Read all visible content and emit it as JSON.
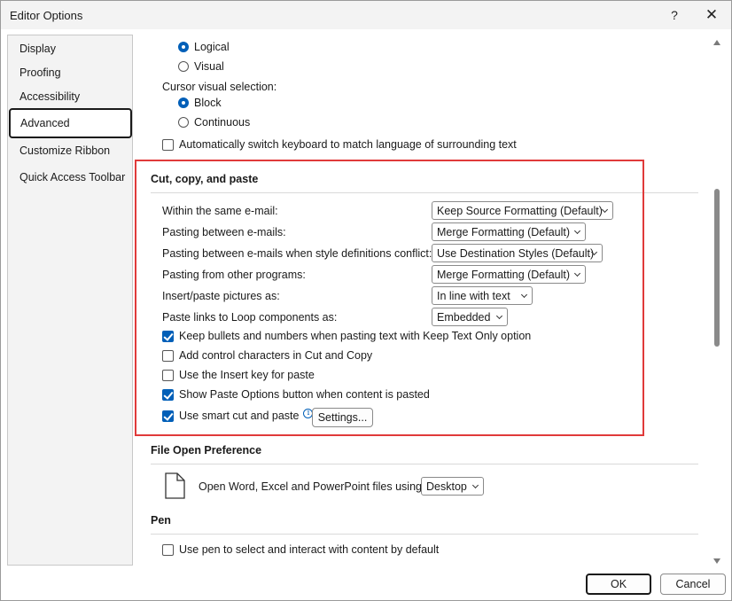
{
  "window": {
    "title": "Editor Options",
    "help_label": "?",
    "close_label": "✕"
  },
  "sidebar": {
    "items": [
      {
        "label": "Display"
      },
      {
        "label": "Proofing"
      },
      {
        "label": "Accessibility"
      },
      {
        "label": "Advanced",
        "selected": true
      },
      {
        "label": "Customize Ribbon"
      },
      {
        "label": "Quick Access Toolbar"
      }
    ]
  },
  "top": {
    "radio_logical": "Logical",
    "radio_visual": "Visual",
    "cursor_label": "Cursor visual selection:",
    "radio_block": "Block",
    "radio_continuous": "Continuous",
    "auto_keyboard": "Automatically switch keyboard to match language of surrounding text"
  },
  "cut_copy_paste": {
    "heading": "Cut, copy, and paste",
    "rows": [
      {
        "label": "Within the same e-mail:",
        "value": "Keep Source Formatting (Default)"
      },
      {
        "label": "Pasting between e-mails:",
        "value": "Merge Formatting (Default)"
      },
      {
        "label": "Pasting between e-mails when style definitions conflict:",
        "value": "Use Destination Styles (Default)"
      },
      {
        "label": "Pasting from other programs:",
        "value": "Merge Formatting (Default)"
      },
      {
        "label": "Insert/paste pictures as:",
        "value": "In line with text"
      },
      {
        "label": "Paste links to Loop components as:",
        "value": "Embedded"
      }
    ],
    "checks": [
      {
        "label": "Keep bullets and numbers when pasting text with Keep Text Only option",
        "checked": true
      },
      {
        "label": "Add control characters in Cut and Copy",
        "checked": false
      },
      {
        "label": "Use the Insert key for paste",
        "checked": false
      },
      {
        "label": "Show Paste Options button when content is pasted",
        "checked": true
      },
      {
        "label": "Use smart cut and paste",
        "checked": true
      }
    ],
    "settings_label": "Settings..."
  },
  "file_open": {
    "heading": "File Open Preference",
    "label": "Open Word, Excel and PowerPoint files using:",
    "value": "Desktop"
  },
  "pen": {
    "heading": "Pen",
    "check_label": "Use pen to select and interact with content by default",
    "checked": false
  },
  "footer": {
    "ok_label": "OK",
    "cancel_label": "Cancel"
  },
  "colors": {
    "accent": "#005fb8",
    "highlight_box": "#e03a3a"
  }
}
